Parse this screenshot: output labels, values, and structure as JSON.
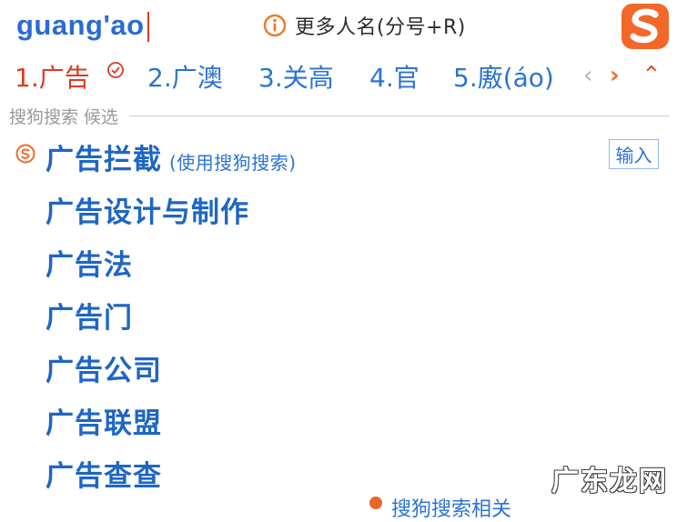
{
  "input": {
    "pinyin": "guang'ao"
  },
  "hint": {
    "more_names": "更多人名(分号+R)"
  },
  "candidates": [
    {
      "num": "1.",
      "word": "广告",
      "selected": true
    },
    {
      "num": "2.",
      "word": "广澳"
    },
    {
      "num": "3.",
      "word": "关高"
    },
    {
      "num": "4.",
      "word": "官"
    },
    {
      "num": "5.",
      "word": "廒(áo)"
    }
  ],
  "nav": {
    "prev": "‹",
    "next": "›",
    "collapse": "⌃"
  },
  "section": {
    "label": "搜狗搜索 候选"
  },
  "suggestions": [
    {
      "text": "广告拦截",
      "note": "(使用搜狗搜索)"
    },
    {
      "text": "广告设计与制作"
    },
    {
      "text": "广告法"
    },
    {
      "text": "广告门"
    },
    {
      "text": "广告公司"
    },
    {
      "text": "广告联盟"
    },
    {
      "text": "广告查查"
    }
  ],
  "input_button": "输入",
  "bottom_partial": "搜狗搜索相关",
  "watermark": "广东龙网",
  "colors": {
    "accent_blue": "#1e66c4",
    "selected_red": "#dd3a22",
    "brand_orange": "#f06a2a"
  },
  "icons": [
    "info-icon",
    "sogou-logo-icon",
    "check-circle-icon",
    "sogou-s-icon"
  ]
}
